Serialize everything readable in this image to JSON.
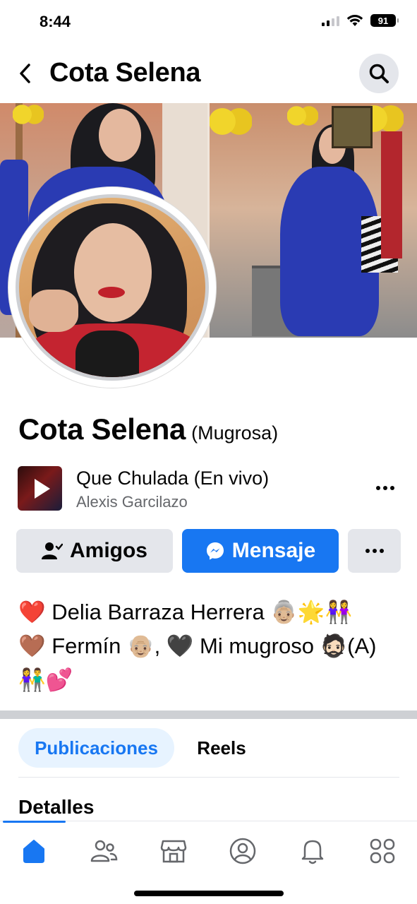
{
  "status_bar": {
    "time": "8:44",
    "battery": "91",
    "icons": [
      "cellular-signal-icon",
      "wifi-icon",
      "battery-icon"
    ]
  },
  "header": {
    "title": "Cota Selena",
    "back_icon": "chevron-left-icon",
    "search_icon": "search-icon"
  },
  "profile": {
    "name": "Cota Selena",
    "alias": "(Mugrosa)"
  },
  "song": {
    "title": "Que Chulada (En vivo)",
    "artist": "Alexis Garcilazo",
    "play_icon": "play-icon",
    "more_icon": "more-horizontal-icon"
  },
  "actions": {
    "friends_label": "Amigos",
    "message_label": "Mensaje",
    "friends_icon": "friend-check-icon",
    "message_icon": "messenger-icon",
    "more_icon": "more-horizontal-icon"
  },
  "bio": {
    "lines": [
      "❤️ Delia Barraza Herrera 👵🏼🌟👭",
      "🤎 Fermín 👴🏼, 🖤 Mi mugroso 🧔🏻(A)",
      "👫💕"
    ]
  },
  "tabs": [
    {
      "label": "Publicaciones",
      "active": true
    },
    {
      "label": "Reels",
      "active": false
    }
  ],
  "details": {
    "heading": "Detalles"
  },
  "bottom_nav": {
    "items": [
      "home-icon",
      "friends-icon",
      "marketplace-icon",
      "profile-icon",
      "notifications-icon",
      "menu-grid-icon"
    ],
    "active": "home-icon"
  },
  "colors": {
    "accent": "#1877f2",
    "button_gray": "#e4e6eb",
    "secondary_text": "#65676b",
    "active_tab_bg": "#e7f3ff"
  }
}
